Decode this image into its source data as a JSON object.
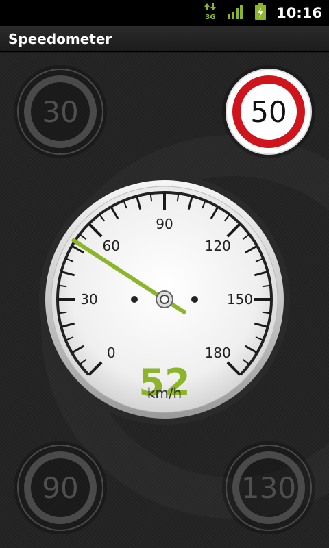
{
  "status_bar": {
    "network": "3G",
    "time": "10:16",
    "icons": [
      "data-activity-icon",
      "signal-strength-icon",
      "battery-charging-icon"
    ]
  },
  "app": {
    "title": "Speedometer"
  },
  "speed_limits": [
    {
      "value": "30",
      "active": false
    },
    {
      "value": "50",
      "active": true
    },
    {
      "value": "90",
      "active": false
    },
    {
      "value": "130",
      "active": false
    }
  ],
  "gauge": {
    "current_speed": 52,
    "speed_display": "52",
    "unit": "km/h",
    "scale_min": 0,
    "scale_max": 180,
    "tick_labels": [
      "0",
      "30",
      "60",
      "90",
      "120",
      "150",
      "180"
    ],
    "needle_color": "#8db52b"
  },
  "colors": {
    "speed_text": "#8db52b",
    "active_limit_ring": "#d0141c",
    "inactive_limit": "#4a4a4a"
  }
}
